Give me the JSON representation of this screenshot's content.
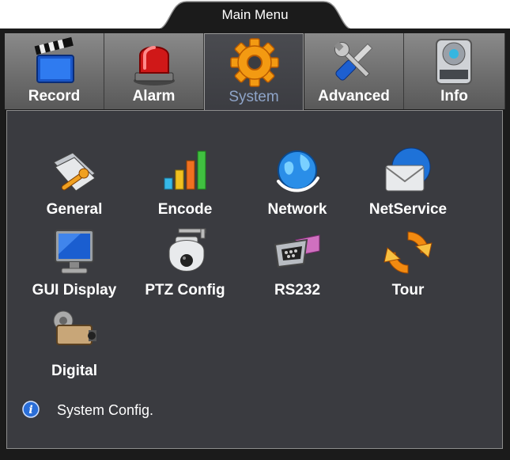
{
  "window": {
    "title": "Main Menu"
  },
  "tabs": [
    {
      "label": "Record",
      "icon": "clapperboard-icon"
    },
    {
      "label": "Alarm",
      "icon": "alarm-siren-icon"
    },
    {
      "label": "System",
      "icon": "gear-icon",
      "active": true
    },
    {
      "label": "Advanced",
      "icon": "wrench-screwdriver-icon"
    },
    {
      "label": "Info",
      "icon": "hard-drive-icon"
    }
  ],
  "items": [
    {
      "label": "General",
      "icon": "folder-wrench-icon"
    },
    {
      "label": "Encode",
      "icon": "bar-chart-icon"
    },
    {
      "label": "Network",
      "icon": "globe-icon"
    },
    {
      "label": "NetService",
      "icon": "envelope-icon"
    },
    {
      "label": "GUI Display",
      "icon": "monitor-icon"
    },
    {
      "label": "PTZ Config",
      "icon": "ptz-camera-icon"
    },
    {
      "label": "RS232",
      "icon": "serial-port-icon"
    },
    {
      "label": "Tour",
      "icon": "refresh-cycle-icon"
    },
    {
      "label": "Digital",
      "icon": "digital-camera-icon"
    }
  ],
  "status": {
    "text": "System Config."
  },
  "colors": {
    "panel": "#3a3b40",
    "active_tab_label": "#8ea4c8",
    "frame": "#1b1b1b"
  }
}
